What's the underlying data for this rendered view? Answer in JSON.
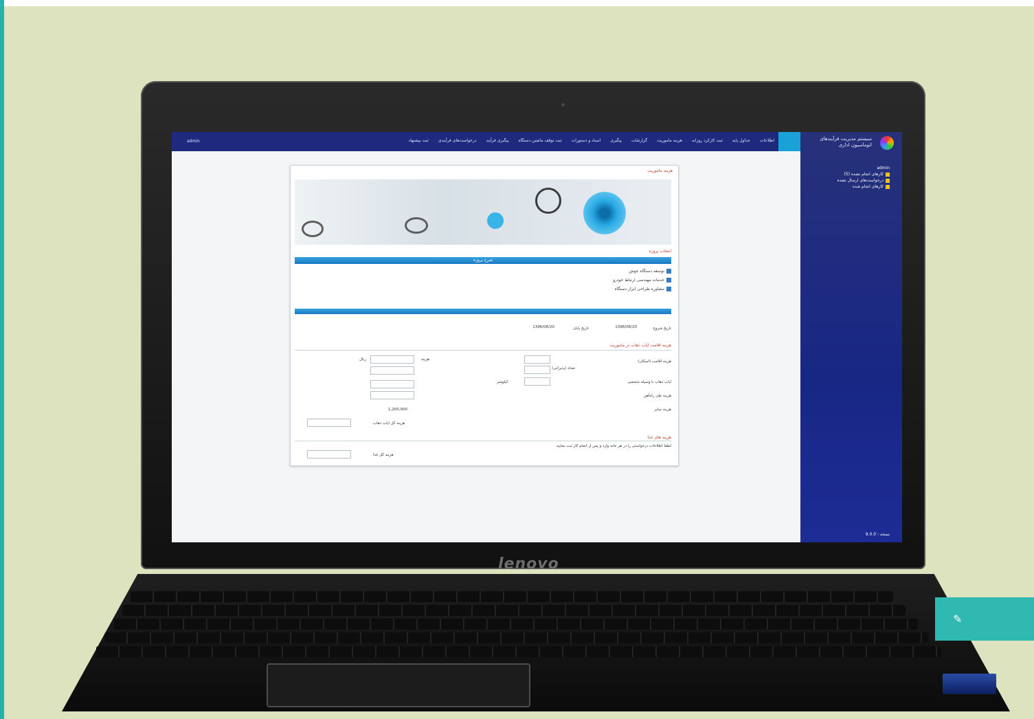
{
  "screen": {
    "brand": "lenovo",
    "nav": {
      "items": [
        "اطلاعات",
        "جداول پایه",
        "ثبت کارکرد روزانه",
        "هزینه ماموریت",
        "گزارشات",
        "پیگیری",
        "اسناد و دستورات",
        "ثبت توقف ماشین دستگاه",
        "پیگیری فرآیند",
        "درخواست‌های فرآیندی",
        "ثبت پیشنهاد"
      ],
      "user": "admin"
    },
    "sidebar": {
      "logo_text": "سیستم مدیریت فرآیندهای اتوماسیون اداری",
      "user": "admin",
      "items": [
        "کارهای انجام نشده (5)",
        "درخواست‌های ارسال نشده",
        "کارهای انجام شده"
      ],
      "footer": "نسخه : 9.0.0"
    },
    "panel": {
      "title": "هزینه ماموریت",
      "project_section": "انتخاب پروژه",
      "bar_title": "شرح پروژه",
      "projects": [
        "توسعه دستگاه جوش",
        "خدمات مهندسی ارتباط خودرو",
        "مشاوره طراحی ابزار دستگاه"
      ],
      "form_section": "هزینه اقامت ایاب ذهاب در ماموریت",
      "labels": {
        "start_date": "تاریخ شروع",
        "end_date": "تاریخ پایان",
        "date_value": "1396/06/20",
        "lodging": "هزینه اقامت (اسکان)",
        "meal": "تعداد (پذیرائی)",
        "transport": "ایاب ذهاب با وسیله شخصی",
        "km": "کیلومتر",
        "trip": "هزینه طی راه‌آهن",
        "other": "هزینه سایر",
        "total_transport": "هزینه کل ایاب ذهاب",
        "cost": "هزینه",
        "rial": "ریال",
        "amount": "1,200,000"
      },
      "cost_section": "هزینه های غذا",
      "cost_note": "لطفا اطلاعات درخواستی را در هر خانه وارد و پس از اتمام کار ثبت نمایید",
      "total_food": "هزینه کل غذا"
    }
  }
}
